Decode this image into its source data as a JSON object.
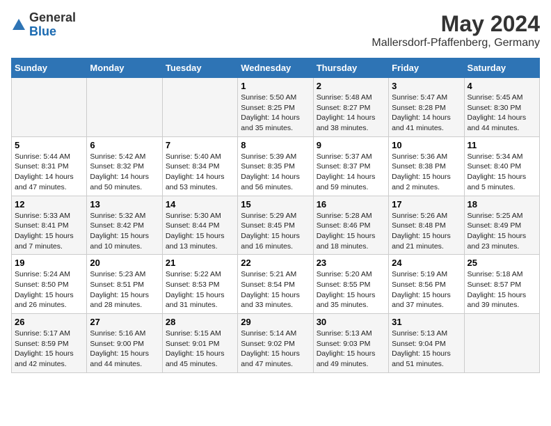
{
  "header": {
    "logo_general": "General",
    "logo_blue": "Blue",
    "title": "May 2024",
    "subtitle": "Mallersdorf-Pfaffenberg, Germany"
  },
  "days_of_week": [
    "Sunday",
    "Monday",
    "Tuesday",
    "Wednesday",
    "Thursday",
    "Friday",
    "Saturday"
  ],
  "weeks": [
    [
      {
        "day": "",
        "info": ""
      },
      {
        "day": "",
        "info": ""
      },
      {
        "day": "",
        "info": ""
      },
      {
        "day": "1",
        "info": "Sunrise: 5:50 AM\nSunset: 8:25 PM\nDaylight: 14 hours\nand 35 minutes."
      },
      {
        "day": "2",
        "info": "Sunrise: 5:48 AM\nSunset: 8:27 PM\nDaylight: 14 hours\nand 38 minutes."
      },
      {
        "day": "3",
        "info": "Sunrise: 5:47 AM\nSunset: 8:28 PM\nDaylight: 14 hours\nand 41 minutes."
      },
      {
        "day": "4",
        "info": "Sunrise: 5:45 AM\nSunset: 8:30 PM\nDaylight: 14 hours\nand 44 minutes."
      }
    ],
    [
      {
        "day": "5",
        "info": "Sunrise: 5:44 AM\nSunset: 8:31 PM\nDaylight: 14 hours\nand 47 minutes."
      },
      {
        "day": "6",
        "info": "Sunrise: 5:42 AM\nSunset: 8:32 PM\nDaylight: 14 hours\nand 50 minutes."
      },
      {
        "day": "7",
        "info": "Sunrise: 5:40 AM\nSunset: 8:34 PM\nDaylight: 14 hours\nand 53 minutes."
      },
      {
        "day": "8",
        "info": "Sunrise: 5:39 AM\nSunset: 8:35 PM\nDaylight: 14 hours\nand 56 minutes."
      },
      {
        "day": "9",
        "info": "Sunrise: 5:37 AM\nSunset: 8:37 PM\nDaylight: 14 hours\nand 59 minutes."
      },
      {
        "day": "10",
        "info": "Sunrise: 5:36 AM\nSunset: 8:38 PM\nDaylight: 15 hours\nand 2 minutes."
      },
      {
        "day": "11",
        "info": "Sunrise: 5:34 AM\nSunset: 8:40 PM\nDaylight: 15 hours\nand 5 minutes."
      }
    ],
    [
      {
        "day": "12",
        "info": "Sunrise: 5:33 AM\nSunset: 8:41 PM\nDaylight: 15 hours\nand 7 minutes."
      },
      {
        "day": "13",
        "info": "Sunrise: 5:32 AM\nSunset: 8:42 PM\nDaylight: 15 hours\nand 10 minutes."
      },
      {
        "day": "14",
        "info": "Sunrise: 5:30 AM\nSunset: 8:44 PM\nDaylight: 15 hours\nand 13 minutes."
      },
      {
        "day": "15",
        "info": "Sunrise: 5:29 AM\nSunset: 8:45 PM\nDaylight: 15 hours\nand 16 minutes."
      },
      {
        "day": "16",
        "info": "Sunrise: 5:28 AM\nSunset: 8:46 PM\nDaylight: 15 hours\nand 18 minutes."
      },
      {
        "day": "17",
        "info": "Sunrise: 5:26 AM\nSunset: 8:48 PM\nDaylight: 15 hours\nand 21 minutes."
      },
      {
        "day": "18",
        "info": "Sunrise: 5:25 AM\nSunset: 8:49 PM\nDaylight: 15 hours\nand 23 minutes."
      }
    ],
    [
      {
        "day": "19",
        "info": "Sunrise: 5:24 AM\nSunset: 8:50 PM\nDaylight: 15 hours\nand 26 minutes."
      },
      {
        "day": "20",
        "info": "Sunrise: 5:23 AM\nSunset: 8:51 PM\nDaylight: 15 hours\nand 28 minutes."
      },
      {
        "day": "21",
        "info": "Sunrise: 5:22 AM\nSunset: 8:53 PM\nDaylight: 15 hours\nand 31 minutes."
      },
      {
        "day": "22",
        "info": "Sunrise: 5:21 AM\nSunset: 8:54 PM\nDaylight: 15 hours\nand 33 minutes."
      },
      {
        "day": "23",
        "info": "Sunrise: 5:20 AM\nSunset: 8:55 PM\nDaylight: 15 hours\nand 35 minutes."
      },
      {
        "day": "24",
        "info": "Sunrise: 5:19 AM\nSunset: 8:56 PM\nDaylight: 15 hours\nand 37 minutes."
      },
      {
        "day": "25",
        "info": "Sunrise: 5:18 AM\nSunset: 8:57 PM\nDaylight: 15 hours\nand 39 minutes."
      }
    ],
    [
      {
        "day": "26",
        "info": "Sunrise: 5:17 AM\nSunset: 8:59 PM\nDaylight: 15 hours\nand 42 minutes."
      },
      {
        "day": "27",
        "info": "Sunrise: 5:16 AM\nSunset: 9:00 PM\nDaylight: 15 hours\nand 44 minutes."
      },
      {
        "day": "28",
        "info": "Sunrise: 5:15 AM\nSunset: 9:01 PM\nDaylight: 15 hours\nand 45 minutes."
      },
      {
        "day": "29",
        "info": "Sunrise: 5:14 AM\nSunset: 9:02 PM\nDaylight: 15 hours\nand 47 minutes."
      },
      {
        "day": "30",
        "info": "Sunrise: 5:13 AM\nSunset: 9:03 PM\nDaylight: 15 hours\nand 49 minutes."
      },
      {
        "day": "31",
        "info": "Sunrise: 5:13 AM\nSunset: 9:04 PM\nDaylight: 15 hours\nand 51 minutes."
      },
      {
        "day": "",
        "info": ""
      }
    ]
  ]
}
